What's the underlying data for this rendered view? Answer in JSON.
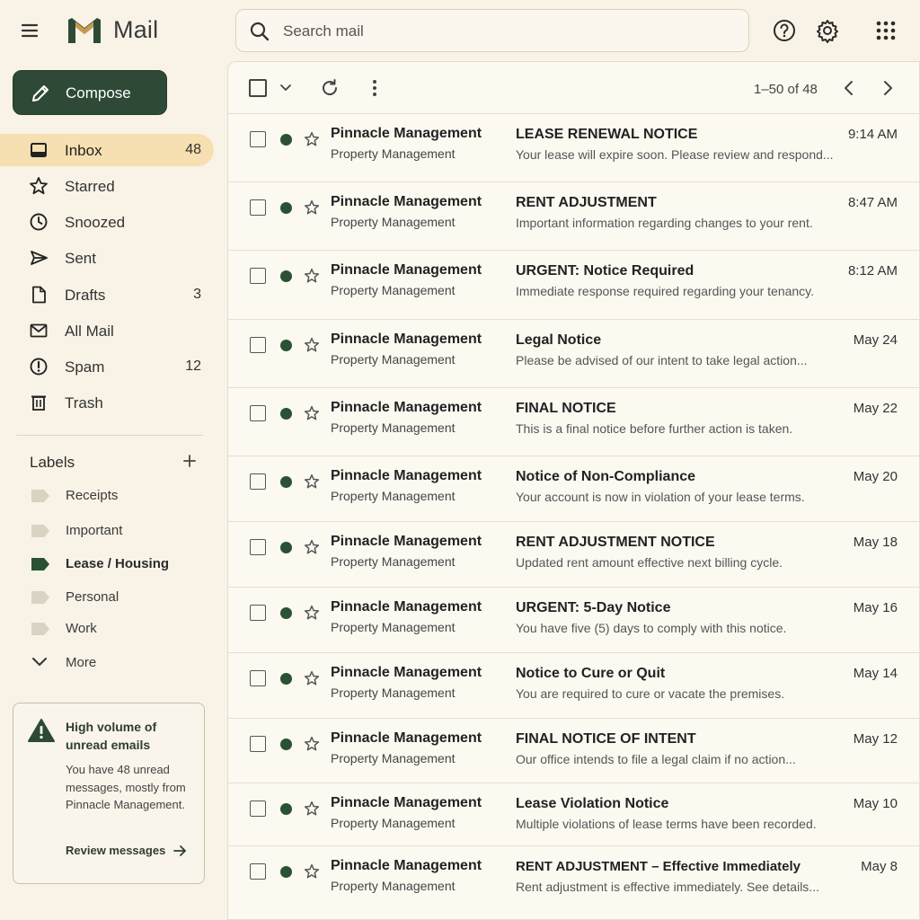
{
  "app": {
    "title": "Mail"
  },
  "search": {
    "placeholder": "Search mail"
  },
  "header_icons": [
    "help-icon",
    "settings-icon",
    "apps-grid-icon"
  ],
  "compose": {
    "label": "Compose"
  },
  "nav": [
    {
      "label": "Inbox",
      "count": "48",
      "icon": "inbox-icon",
      "active": true
    },
    {
      "label": "Starred",
      "count": "",
      "icon": "star-icon"
    },
    {
      "label": "Snoozed",
      "count": "",
      "icon": "clock-icon"
    },
    {
      "label": "Sent",
      "count": "",
      "icon": "send-icon"
    },
    {
      "label": "Drafts",
      "count": "3",
      "icon": "draft-icon"
    },
    {
      "label": "All Mail",
      "count": "",
      "icon": "mail-icon"
    },
    {
      "label": "Spam",
      "count": "12",
      "icon": "spam-icon"
    },
    {
      "label": "Trash",
      "count": "",
      "icon": "trash-icon"
    }
  ],
  "labels": {
    "title": "Labels",
    "items": [
      {
        "label": "Receipts",
        "color": "#d9d3c3"
      },
      {
        "label": "Important",
        "color": "#d9d3c3"
      },
      {
        "label": "Lease / Housing",
        "color": "#2b5134",
        "bold": true
      },
      {
        "label": "Personal",
        "color": "#d9d3c3"
      },
      {
        "label": "Work",
        "color": "#d9d3c3"
      }
    ],
    "more_label": "More"
  },
  "alert": {
    "title": "High volume of unread emails",
    "body": "You have 48 unread messages, mostly from Pinnacle Management.",
    "link": "Review messages"
  },
  "toolbar": {
    "pager": "1–50 of 48"
  },
  "colors": {
    "accent": "#2e4a36",
    "unread_dot": "#2b5134",
    "background": "#f8f3e6",
    "active_nav": "#f6dfb0"
  },
  "emails": [
    {
      "sender": "Pinnacle Management",
      "org": "Property Management",
      "subject": "LEASE RENEWAL NOTICE",
      "snippet": "Your lease will expire soon. Please review and respond...",
      "time": "9:14 AM"
    },
    {
      "sender": "Pinnacle Management",
      "org": "Property Management",
      "subject": "RENT ADJUSTMENT",
      "snippet": "Important information regarding changes to your rent.",
      "time": "8:47 AM"
    },
    {
      "sender": "Pinnacle Management",
      "org": "Property Management",
      "subject": "URGENT: Notice Required",
      "snippet": "Immediate response required regarding your tenancy.",
      "time": "8:12 AM"
    },
    {
      "sender": "Pinnacle Management",
      "org": "Property Management",
      "subject": "Legal Notice",
      "snippet": "Please be advised of our intent to take legal action...",
      "time": "May 24"
    },
    {
      "sender": "Pinnacle Management",
      "org": "Property Management",
      "subject": "FINAL NOTICE",
      "snippet": "This is a final notice before further action is taken.",
      "time": "May 22"
    },
    {
      "sender": "Pinnacle Management",
      "org": "Property Management",
      "subject": "Notice of Non-Compliance",
      "snippet": "Your account is now in violation of your lease terms.",
      "time": "May 20"
    },
    {
      "sender": "Pinnacle Management",
      "org": "Property Management",
      "subject": "RENT ADJUSTMENT NOTICE",
      "snippet": "Updated rent amount effective next billing cycle.",
      "time": "May 18"
    },
    {
      "sender": "Pinnacle Management",
      "org": "Property Management",
      "subject": "URGENT: 5-Day Notice",
      "snippet": "You have five (5) days to comply with this notice.",
      "time": "May 16"
    },
    {
      "sender": "Pinnacle Management",
      "org": "Property Management",
      "subject": "Notice to Cure or Quit",
      "snippet": "You are required to cure or vacate the premises.",
      "time": "May 14"
    },
    {
      "sender": "Pinnacle Management",
      "org": "Property Management",
      "subject": "FINAL NOTICE OF INTENT",
      "snippet": "Our office intends to file a legal claim if no action...",
      "time": "May 12"
    },
    {
      "sender": "Pinnacle Management",
      "org": "Property Management",
      "subject": "Lease Violation Notice",
      "snippet": "Multiple violations of lease terms have been recorded.",
      "time": "May 10"
    },
    {
      "sender": "Pinnacle Management",
      "org": "Property Management",
      "subject": "RENT ADJUSTMENT – Effective Immediately",
      "snippet": "Rent adjustment is effective immediately. See details...",
      "time": "May 8"
    }
  ]
}
